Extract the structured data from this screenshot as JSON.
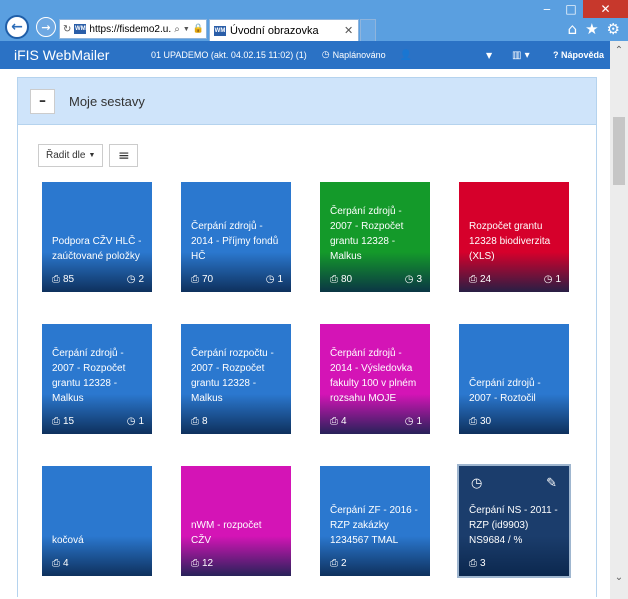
{
  "browser": {
    "address": "https://fisdemo2.u...",
    "tab_title": "Úvodní obrazovka",
    "favicon": "WM"
  },
  "app": {
    "brand": "iFIS WebMailer",
    "status": "01 UPADEMO (akt. 04.02.15 11:02) (1)",
    "planned": "Naplánováno",
    "help": "Nápověda"
  },
  "panel": {
    "title": "Moje sestavy",
    "sort_label": "Řadit dle"
  },
  "colors": {
    "blue": "#2b78cf",
    "green": "#149a2a",
    "red": "#d6002b",
    "magenta": "#d414b6",
    "navy": "#1b3d6c"
  },
  "tiles": [
    {
      "title": "Podpora CŽV HLČ - zaúčtované položky",
      "prints": "85",
      "scheduled": "2",
      "color": "#2b78cf"
    },
    {
      "title": "Čerpání zdrojů - 2014 - Příjmy fondů HČ",
      "prints": "70",
      "scheduled": "1",
      "color": "#2b78cf"
    },
    {
      "title": "Čerpání zdrojů - 2007 - Rozpočet grantu 12328 - Malkus",
      "prints": "80",
      "scheduled": "3",
      "color": "#149a2a"
    },
    {
      "title": "Rozpočet grantu 12328 biodiverzita (XLS)",
      "prints": "24",
      "scheduled": "1",
      "color": "#d6002b"
    },
    {
      "title": "Čerpání zdrojů - 2007 - Rozpočet grantu 12328 - Malkus",
      "prints": "15",
      "scheduled": "1",
      "color": "#2b78cf"
    },
    {
      "title": "Čerpání rozpočtu - 2007 - Rozpočet grantu 12328 - Malkus",
      "prints": "8",
      "scheduled": "",
      "color": "#2b78cf"
    },
    {
      "title": "Čerpání zdrojů - 2014 - Výsledovka fakulty 100 v plném rozsahu MOJE",
      "prints": "4",
      "scheduled": "1",
      "color": "#d414b6"
    },
    {
      "title": "Čerpání zdrojů - 2007 - Roztočil",
      "prints": "30",
      "scheduled": "",
      "color": "#2b78cf"
    },
    {
      "title": "kočová",
      "prints": "4",
      "scheduled": "",
      "color": "#2b78cf"
    },
    {
      "title": "nWM - rozpočet CŽV",
      "prints": "12",
      "scheduled": "",
      "color": "#d414b6"
    },
    {
      "title": "Čerpání ZF - 2016 - RZP zakázky 1234567 TMAL",
      "prints": "2",
      "scheduled": "",
      "color": "#2b78cf"
    },
    {
      "title": "Čerpání NS - 2011 - RZP (id9903) NS9684 / %",
      "prints": "3",
      "scheduled": "",
      "color": "#1b3d6c"
    }
  ]
}
